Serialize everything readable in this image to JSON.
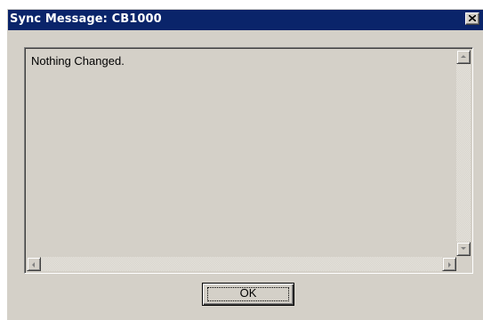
{
  "window": {
    "title": "Sync Message: CB1000"
  },
  "message": {
    "text": "Nothing Changed."
  },
  "buttons": {
    "ok_label": "OK"
  },
  "icons": {
    "close": "close-icon",
    "scroll_up": "arrow-up-icon",
    "scroll_down": "arrow-down-icon",
    "scroll_left": "arrow-left-icon",
    "scroll_right": "arrow-right-icon"
  },
  "colors": {
    "titlebar": "#0a246a",
    "face": "#d4d0c8"
  }
}
